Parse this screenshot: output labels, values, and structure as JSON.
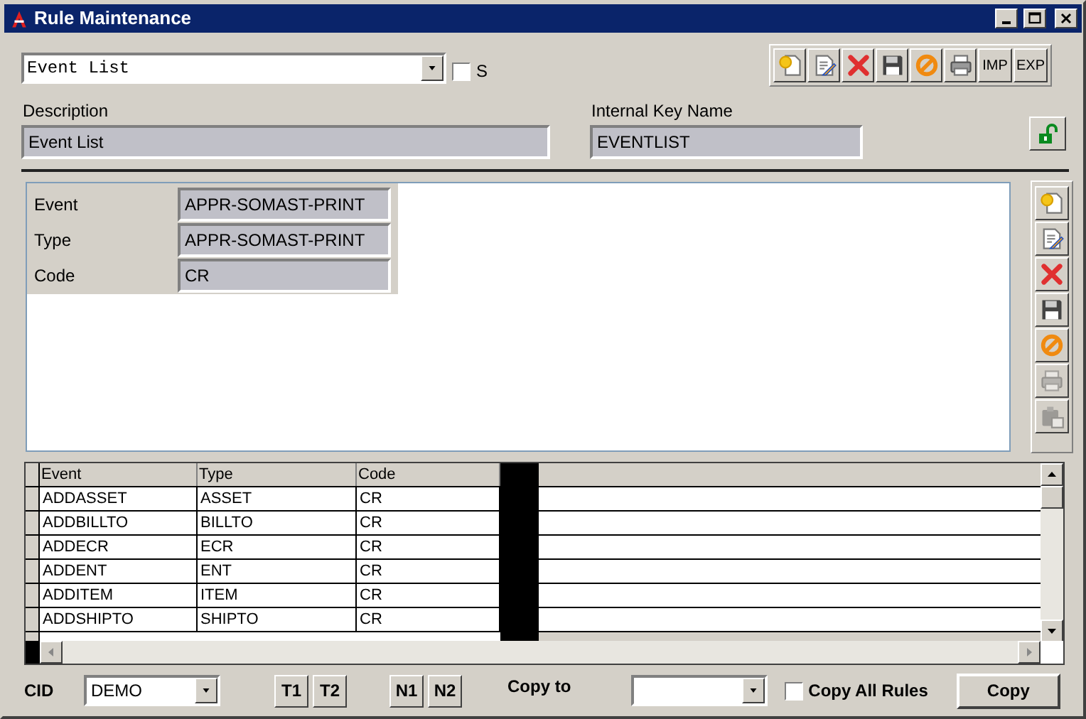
{
  "window": {
    "title": "Rule Maintenance"
  },
  "rule_select": {
    "value": "Event List"
  },
  "s_checkbox": {
    "label": "S",
    "checked": false
  },
  "toolbar": [
    {
      "kind": "new"
    },
    {
      "kind": "edit"
    },
    {
      "kind": "delete"
    },
    {
      "kind": "save"
    },
    {
      "kind": "cancel"
    },
    {
      "kind": "print"
    },
    {
      "kind": "text",
      "label": "IMP"
    },
    {
      "kind": "text",
      "label": "EXP"
    }
  ],
  "description": {
    "label": "Description",
    "value": "Event List"
  },
  "internal_key_name": {
    "label": "Internal Key Name",
    "value": "EVENTLIST"
  },
  "detail": [
    {
      "label": "Event",
      "value": "APPR-SOMAST-PRINT"
    },
    {
      "label": "Type",
      "value": "APPR-SOMAST-PRINT"
    },
    {
      "label": "Code",
      "value": "CR"
    }
  ],
  "side_toolbar": [
    {
      "kind": "new",
      "disabled": false
    },
    {
      "kind": "edit",
      "disabled": false
    },
    {
      "kind": "delete",
      "disabled": false
    },
    {
      "kind": "save",
      "disabled": false
    },
    {
      "kind": "cancel",
      "disabled": false
    },
    {
      "kind": "print",
      "disabled": true
    },
    {
      "kind": "paste",
      "disabled": true
    }
  ],
  "grid": {
    "columns": [
      "Event",
      "Type",
      "Code"
    ],
    "rows": [
      [
        "ADDASSET",
        "ASSET",
        "CR"
      ],
      [
        "ADDBILLTO",
        "BILLTO",
        "CR"
      ],
      [
        "ADDECR",
        "ECR",
        "CR"
      ],
      [
        "ADDENT",
        "ENT",
        "CR"
      ],
      [
        "ADDITEM",
        "ITEM",
        "CR"
      ],
      [
        "ADDSHIPTO",
        "SHIPTO",
        "CR"
      ]
    ]
  },
  "footer": {
    "cid": {
      "label": "CID",
      "value": "DEMO"
    },
    "group_1": [
      "T1",
      "T2"
    ],
    "group_2": [
      "N1",
      "N2"
    ],
    "copy_to": {
      "label": "Copy to"
    },
    "copy_all": {
      "label": "Copy All Rules",
      "checked": false
    },
    "copy_button": "Copy"
  }
}
